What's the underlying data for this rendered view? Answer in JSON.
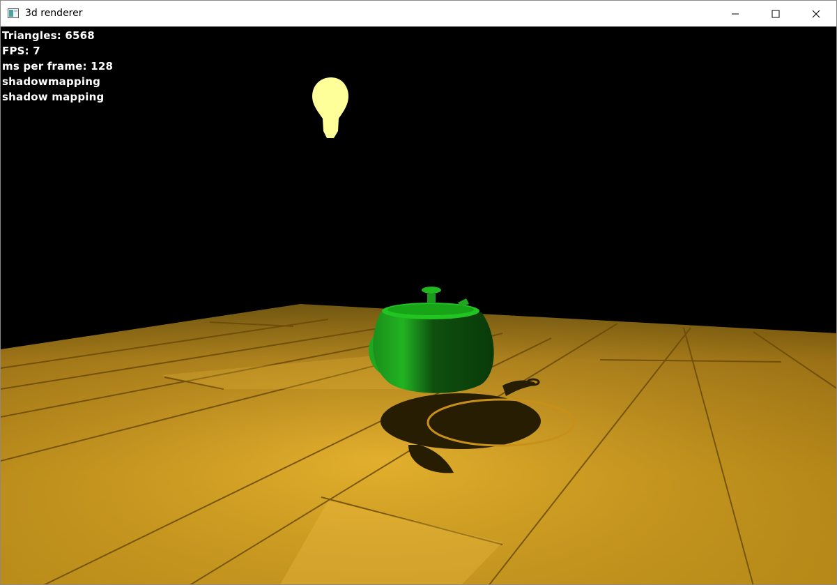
{
  "window": {
    "title": "3d renderer",
    "controls": [
      "minimize-icon",
      "maximize-icon",
      "close-icon"
    ]
  },
  "hud": {
    "triangles": "Triangles: 6568",
    "fps": "FPS: 7",
    "ms_per_frame": "ms per frame: 128",
    "mode_1": "shadowmapping",
    "mode_2": "shadow mapping"
  },
  "scene": {
    "objects": [
      "teapot",
      "light-bulb",
      "wooden-floor",
      "teapot-shadow"
    ],
    "colors": {
      "background": "#000000",
      "teapot": "#1fa81f",
      "light_bulb": "#ffff99",
      "floor": "#d9a21a"
    }
  }
}
